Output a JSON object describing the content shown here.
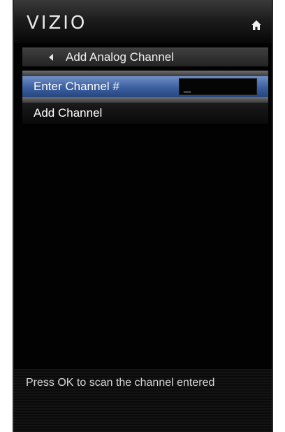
{
  "header": {
    "logo_text": "VIZIO",
    "home_icon": "home-icon"
  },
  "menu": {
    "title": "Add Analog Channel",
    "back_icon": "back-arrow-icon",
    "items": [
      {
        "label": "Enter Channel #",
        "value": "_",
        "selected": true
      },
      {
        "label": "Add Channel",
        "selected": false
      }
    ]
  },
  "help": {
    "text": "Press OK to scan the channel entered"
  },
  "colors": {
    "selection": "#3b5f9f",
    "panel_background": "#020202",
    "text": "#ffffff"
  }
}
